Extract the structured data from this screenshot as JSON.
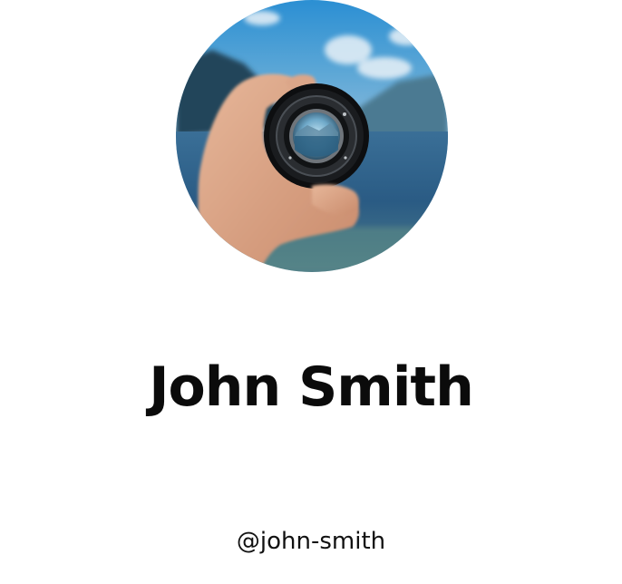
{
  "profile": {
    "name": "John Smith",
    "handle": "@john-smith",
    "avatar_subject": "hand-holding-camera-lens-over-lake"
  },
  "colors": {
    "background": "#ffffff",
    "name_text": "#0b0b0b",
    "handle_text": "#111111",
    "sky": "#2f86c4",
    "water": "#2b5f86"
  }
}
